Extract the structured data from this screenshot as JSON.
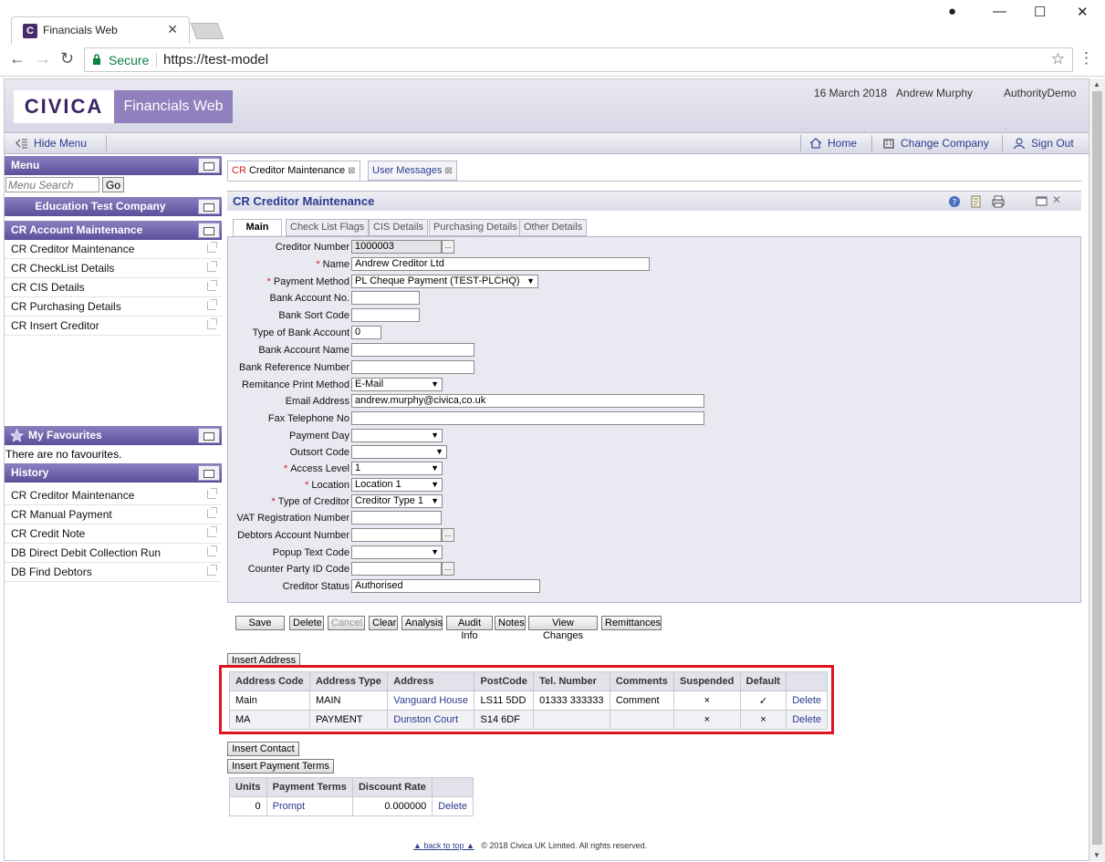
{
  "browser": {
    "tab_title": "Financials Web",
    "favicon_letter": "C",
    "secure_label": "Secure",
    "url": "https://test-model"
  },
  "header": {
    "logo_text": "CIVICA",
    "app_name": "Financials Web",
    "date": "16 March 2018",
    "user": "Andrew Murphy",
    "authority": "AuthorityDemo"
  },
  "menubar": {
    "hide_menu": "Hide Menu",
    "home": "Home",
    "change_company": "Change Company",
    "sign_out": "Sign Out"
  },
  "sidebar": {
    "menu_title": "Menu",
    "menu_search_placeholder": "Menu Search",
    "go_label": "Go",
    "company": "Education Test Company",
    "section": "CR Account Maintenance",
    "items": [
      "CR Creditor Maintenance",
      "CR CheckList Details",
      "CR CIS Details",
      "CR Purchasing Details",
      "CR Insert Creditor"
    ],
    "favourites_title": "My Favourites",
    "favourites_empty": "There are no favourites.",
    "history_title": "History",
    "history": [
      "CR Creditor Maintenance",
      "CR Manual Payment",
      "CR Credit Note",
      "DB Direct Debit Collection Run",
      "DB Find Debtors"
    ]
  },
  "page_tabs": [
    {
      "prefix": "CR",
      "label": "Creditor Maintenance"
    },
    {
      "label": "User Messages"
    }
  ],
  "panel_title": "CR Creditor Maintenance",
  "sub_tabs": [
    "Main",
    "Check List Flags",
    "CIS Details",
    "Purchasing Details",
    "Other Details"
  ],
  "form": {
    "creditor_number": {
      "label": "Creditor Number",
      "value": "1000003"
    },
    "name": {
      "label": "Name",
      "value": "Andrew Creditor Ltd"
    },
    "payment_method": {
      "label": "Payment Method",
      "value": "PL Cheque Payment (TEST-PLCHQ)"
    },
    "bank_account_no": {
      "label": "Bank Account No.",
      "value": ""
    },
    "bank_sort_code": {
      "label": "Bank Sort Code",
      "value": ""
    },
    "type_of_bank_account": {
      "label": "Type of Bank Account",
      "value": "0"
    },
    "bank_account_name": {
      "label": "Bank Account Name",
      "value": ""
    },
    "bank_reference_number": {
      "label": "Bank Reference Number",
      "value": ""
    },
    "remittance_print_method": {
      "label": "Remitance Print Method",
      "value": "E-Mail"
    },
    "email_address": {
      "label": "Email Address",
      "value": "andrew.murphy@civica,co.uk"
    },
    "fax_telephone_no": {
      "label": "Fax Telephone No",
      "value": ""
    },
    "payment_day": {
      "label": "Payment Day",
      "value": ""
    },
    "outsort_code": {
      "label": "Outsort Code",
      "value": ""
    },
    "access_level": {
      "label": "Access Level",
      "value": "1"
    },
    "location": {
      "label": "Location",
      "value": "Location 1"
    },
    "type_of_creditor": {
      "label": "Type of Creditor",
      "value": "Creditor Type 1"
    },
    "vat_registration_number": {
      "label": "VAT Registration Number",
      "value": ""
    },
    "debtors_account_number": {
      "label": "Debtors Account Number",
      "value": ""
    },
    "popup_text_code": {
      "label": "Popup Text Code",
      "value": ""
    },
    "counter_party_id_code": {
      "label": "Counter Party ID Code",
      "value": ""
    },
    "creditor_status": {
      "label": "Creditor Status",
      "value": "Authorised"
    },
    "lookup_glyph": "..."
  },
  "actions": [
    "Save",
    "Delete",
    "Cancel",
    "Clear",
    "Analysis",
    "Audit Info",
    "Notes",
    "View Changes",
    "Remittances"
  ],
  "address": {
    "insert_label": "Insert Address",
    "columns": [
      "Address Code",
      "Address Type",
      "Address",
      "PostCode",
      "Tel. Number",
      "Comments",
      "Suspended",
      "Default",
      ""
    ],
    "rows": [
      {
        "code": "Main",
        "type": "MAIN",
        "address": "Vanguard House",
        "postcode": "LS11 5DD",
        "tel": "01333 333333",
        "comments": "Comment",
        "suspended": "×",
        "default": "✓",
        "delete": "Delete"
      },
      {
        "code": "MA",
        "type": "PAYMENT",
        "address": "Dunston Court",
        "postcode": "S14 6DF",
        "tel": "",
        "comments": "",
        "suspended": "×",
        "default": "×",
        "delete": "Delete"
      }
    ]
  },
  "contact": {
    "insert_label": "Insert Contact"
  },
  "payment_terms": {
    "insert_label": "Insert Payment Terms",
    "columns": [
      "Units",
      "Payment Terms",
      "Discount Rate",
      ""
    ],
    "rows": [
      {
        "units": "0",
        "terms": "Prompt",
        "rate": "0.000000",
        "delete": "Delete"
      }
    ]
  },
  "footer": {
    "back_to_top": "back to top",
    "copyright": "© 2018 Civica UK Limited. All rights reserved."
  },
  "colors": {
    "brand": "#3b2466",
    "pane_header": "#5a4f9a",
    "link": "#2a3b8f",
    "required": "#cc2020",
    "highlight": "#e0141e"
  }
}
